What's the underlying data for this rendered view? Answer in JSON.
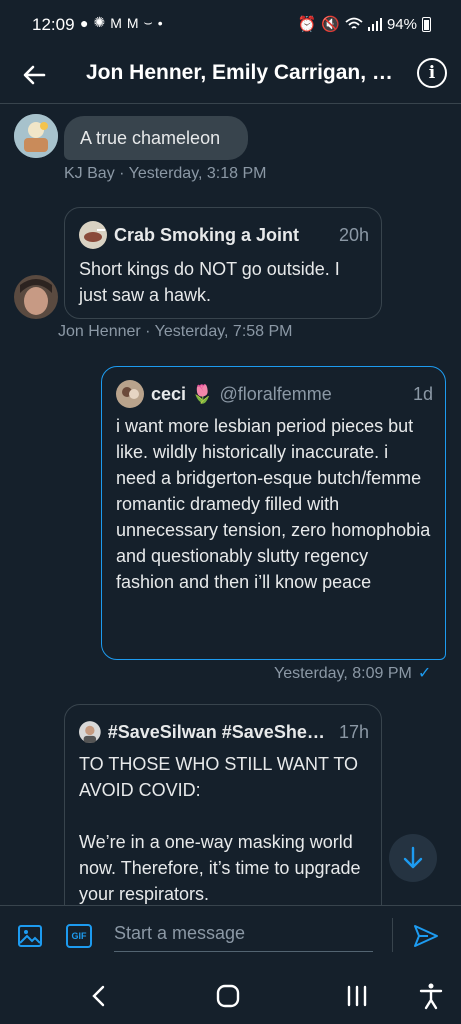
{
  "status_bar": {
    "time": "12:09",
    "battery": "94%"
  },
  "header": {
    "title": "Jon Henner, Emily Carrigan, KJ Bay",
    "info_label": "i"
  },
  "messages": [
    {
      "text": "A true chameleon",
      "meta": "KJ Bay · Yesterday, 3:18 PM"
    },
    {
      "quote": {
        "name": "Crab Smoking a Joint",
        "handle": "",
        "time": "20h",
        "text": "Short kings do NOT go outside. I just saw a hawk."
      },
      "meta": "Jon Henner · Yesterday, 7:58 PM"
    },
    {
      "quote": {
        "name": "ceci 🌷",
        "handle": "@floralfemme",
        "time": "1d",
        "text": "i want more lesbian period pieces but like. wildly historically inaccurate. i need a bridgerton-esque butch/femme romantic dramedy filled with unnecessary tension, zero homophobia and questionably slutty regency fashion and then i’ll know peace"
      },
      "meta": "Yesterday, 8:09 PM"
    },
    {
      "quote": {
        "name": "#SaveSilwan #SaveSheikhJarrah",
        "handle": "",
        "time": "17h",
        "text": "TO THOSE WHO STILL WANT TO AVOID COVID:\n\nWe’re in a one-way masking world now. Therefore, it’s time to upgrade your respirators."
      }
    }
  ],
  "composer": {
    "placeholder": "Start a message",
    "gif_label": "GIF"
  },
  "colors": {
    "background": "#15202b",
    "accent": "#1d9bf0",
    "muted": "#8b98a5"
  }
}
